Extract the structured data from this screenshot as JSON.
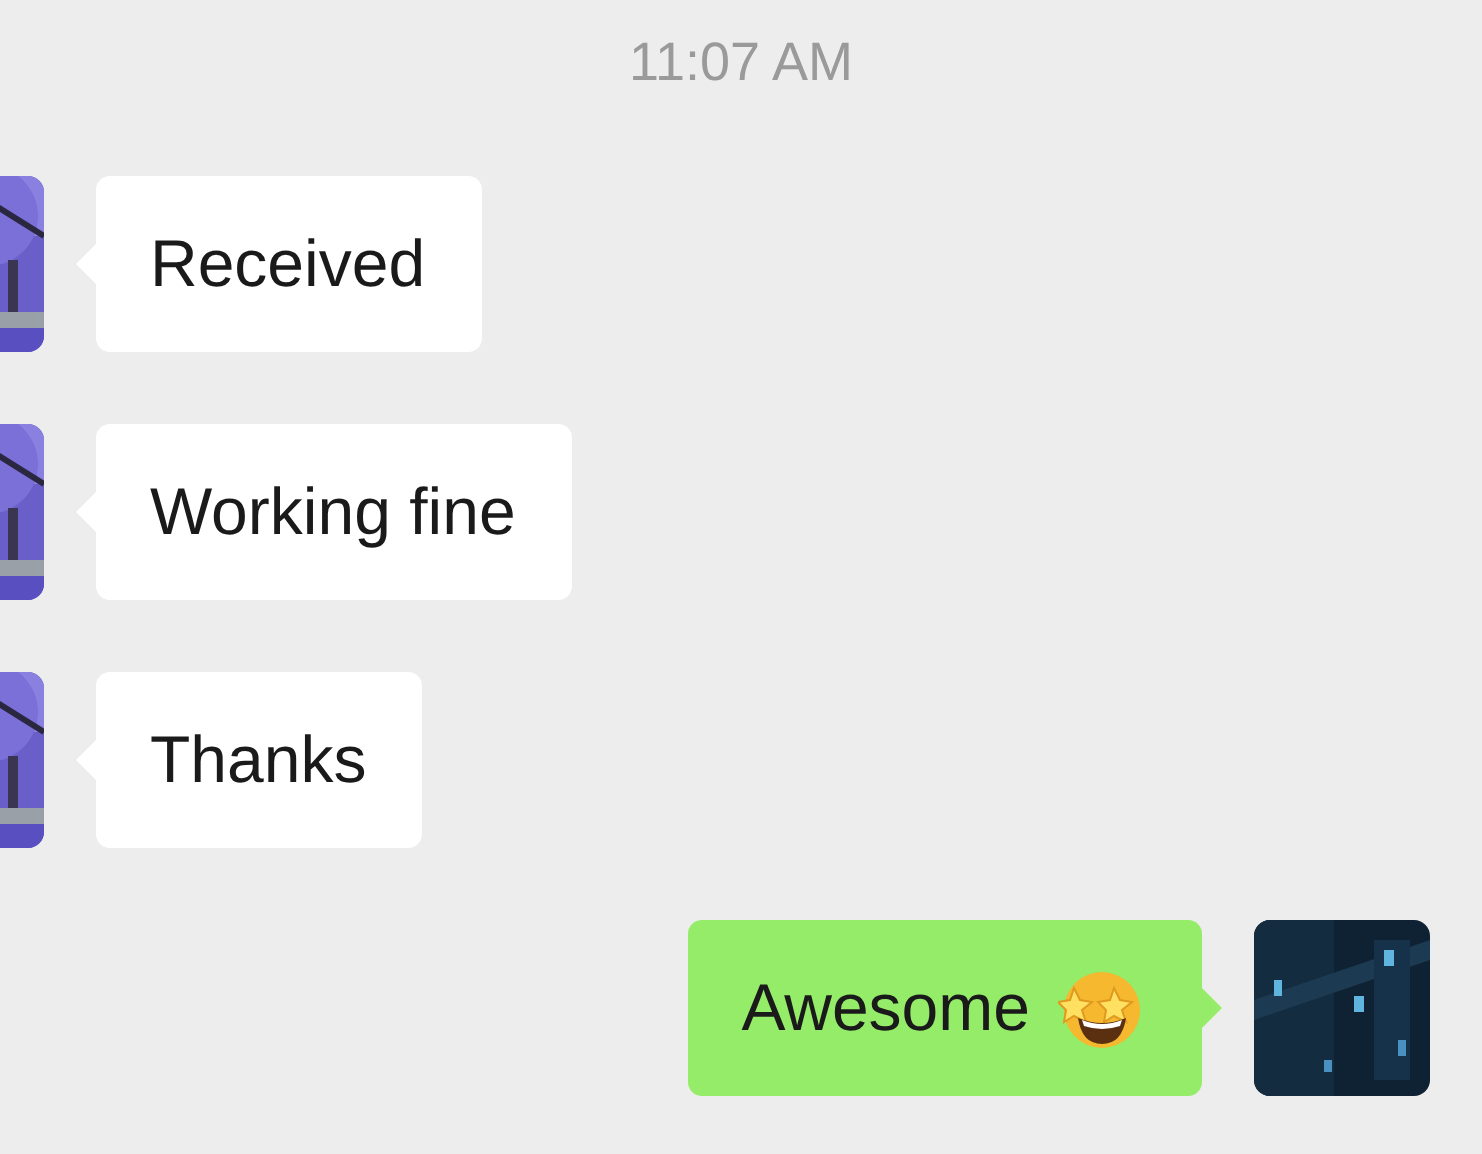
{
  "timestamp": "11:07 AM",
  "messages": [
    {
      "kind": "received",
      "text": "Received",
      "emoji": false
    },
    {
      "kind": "received",
      "text": "Working fine",
      "emoji": false
    },
    {
      "kind": "received",
      "text": "Thanks",
      "emoji": false
    },
    {
      "kind": "sent",
      "text": "Awesome",
      "emoji": true
    }
  ]
}
